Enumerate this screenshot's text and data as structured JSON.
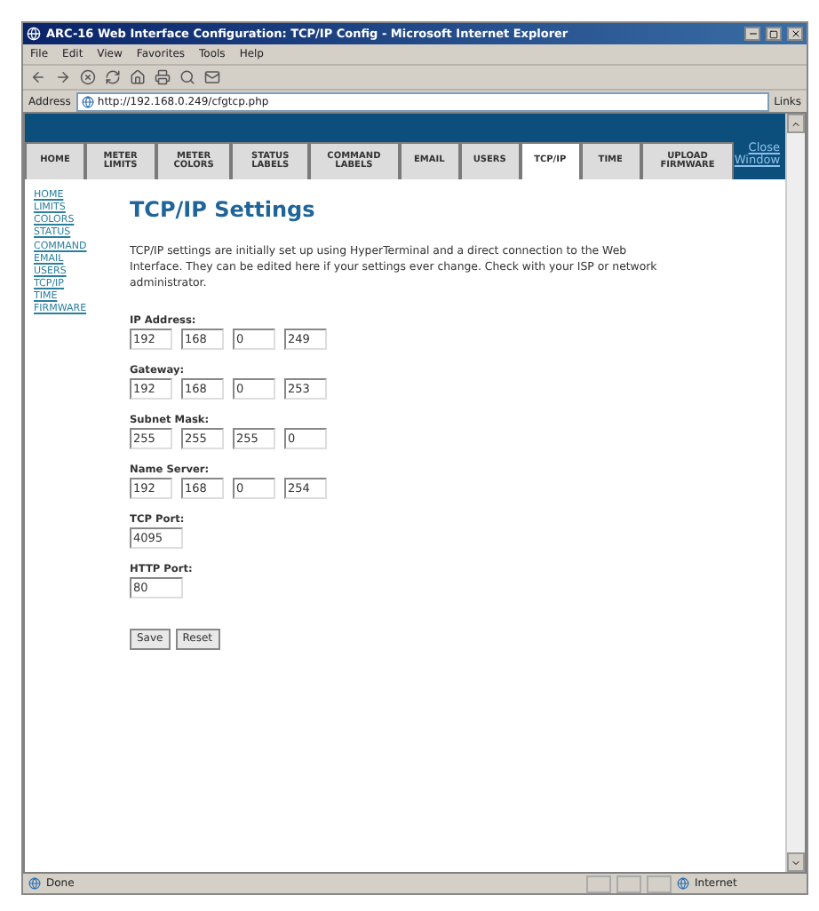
{
  "window": {
    "title": "ARC-16 Web Interface Configuration: TCP/IP Config - Microsoft Internet Explorer"
  },
  "menu": [
    "File",
    "Edit",
    "View",
    "Favorites",
    "Tools",
    "Help"
  ],
  "address_bar": {
    "label": "Address",
    "url": "http://192.168.0.249/cfgtcp.php",
    "links": "Links"
  },
  "tabs": [
    {
      "label": "HOME",
      "selected": false
    },
    {
      "label": "METER LIMITS",
      "selected": false
    },
    {
      "label": "METER COLORS",
      "selected": false
    },
    {
      "label": "STATUS LABELS",
      "selected": false
    },
    {
      "label": "COMMAND LABELS",
      "selected": false
    },
    {
      "label": "EMAIL",
      "selected": false
    },
    {
      "label": "USERS",
      "selected": false
    },
    {
      "label": "TCP/IP",
      "selected": true
    },
    {
      "label": "TIME",
      "selected": false
    },
    {
      "label": "UPLOAD FIRMWARE",
      "selected": false
    }
  ],
  "close_link": "Close Window",
  "sidebar": {
    "items": [
      "HOME",
      "LIMITS",
      "COLORS",
      "STATUS",
      "COMMAND",
      "EMAIL",
      "USERS",
      "TCP/IP",
      "TIME",
      "FIRMWARE"
    ]
  },
  "heading": "TCP/IP Settings",
  "intro": "TCP/IP settings are initially set up using HyperTerminal and a direct connection to the Web Interface. They can be edited here if your settings ever change. Check with your ISP or network administrator.",
  "fields": [
    {
      "label": "IP Address:",
      "kind": "octets",
      "values": [
        "192",
        "168",
        "0",
        "249"
      ]
    },
    {
      "label": "Gateway:",
      "kind": "octets",
      "values": [
        "192",
        "168",
        "0",
        "253"
      ]
    },
    {
      "label": "Subnet Mask:",
      "kind": "octets",
      "values": [
        "255",
        "255",
        "255",
        "0"
      ]
    },
    {
      "label": "Name Server:",
      "kind": "octets",
      "values": [
        "192",
        "168",
        "0",
        "254"
      ]
    },
    {
      "label": "TCP Port:",
      "kind": "port",
      "values": [
        "4095"
      ]
    },
    {
      "label": "HTTP Port:",
      "kind": "port",
      "values": [
        "80"
      ]
    }
  ],
  "buttons": [
    "Save",
    "Reset"
  ],
  "status_bar": {
    "text": "Done",
    "zone": "Internet"
  }
}
